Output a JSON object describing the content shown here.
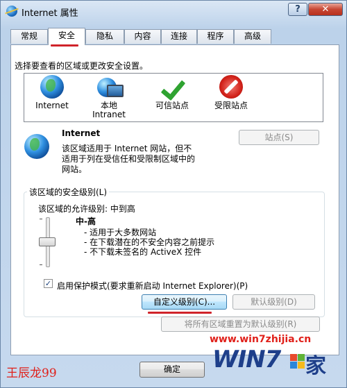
{
  "window": {
    "title": "Internet 属性",
    "help": "?",
    "close": "✕"
  },
  "tabs": [
    {
      "label": "常规"
    },
    {
      "label": "安全"
    },
    {
      "label": "隐私"
    },
    {
      "label": "内容"
    },
    {
      "label": "连接"
    },
    {
      "label": "程序"
    },
    {
      "label": "高级"
    }
  ],
  "security": {
    "select_hint": "选择要查看的区域或更改安全设置。",
    "zones": [
      {
        "label": "Internet",
        "label2": "",
        "icon": "globe-icon"
      },
      {
        "label": "本地",
        "label2": "Intranet",
        "icon": "local-intranet-icon"
      },
      {
        "label": "可信站点",
        "label2": "",
        "icon": "trusted-check-icon"
      },
      {
        "label": "受限站点",
        "label2": "",
        "icon": "restricted-icon"
      }
    ],
    "selected_zone": {
      "title": "Internet",
      "desc_lines": [
        "该区域适用于 Internet 网站，但不",
        "适用于列在受信任和受限制区域中的",
        "网站。"
      ],
      "sites_button": "站点(S)"
    },
    "level_group": {
      "label": "该区域的安全级别(L)",
      "allowed": "该区域的允许级别: 中到高",
      "level_name": "中-高",
      "level_desc": [
        "- 适用于大多数网站",
        "- 在下载潜在的不安全内容之前提示",
        "- 不下载未签名的 ActiveX 控件"
      ],
      "protected_mode_label": "启用保护模式(要求重新启动 Internet Explorer)(P)",
      "protected_mode_checked": true,
      "custom_button": "自定义级别(C)...",
      "default_button": "默认级别(D)"
    },
    "reset_button": "将所有区域重置为默认级别(R)"
  },
  "footer": {
    "ok_button": "确定",
    "watermark_url": "www.win7zhijia.cn",
    "signature": "王辰龙99",
    "logo_text": "WIN7",
    "logo_home": "家"
  },
  "colors": {
    "accent_red": "#d0232a",
    "title_blue": "#bcd2ea"
  }
}
